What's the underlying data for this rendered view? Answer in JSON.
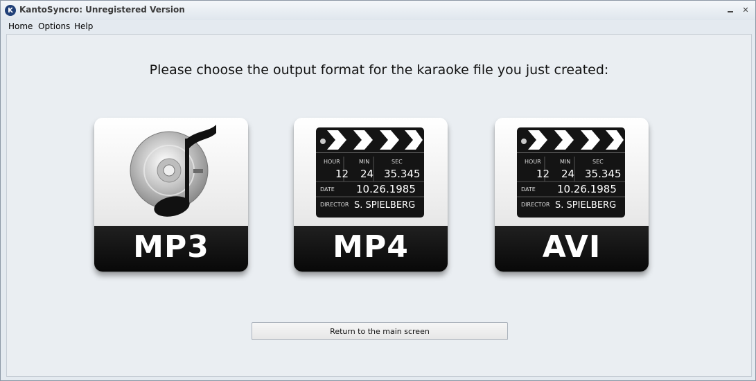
{
  "window": {
    "title": "KantoSyncro: Unregistered Version",
    "app_icon_letter": "K",
    "close_glyph": "✕"
  },
  "menu": {
    "items": [
      "Home",
      "Options",
      "Help"
    ]
  },
  "main": {
    "prompt": "Please choose the output format for the karaoke file you just created:",
    "formats": [
      {
        "label": "MP3",
        "icon": "music-cd-icon"
      },
      {
        "label": "MP4",
        "icon": "clapperboard-icon"
      },
      {
        "label": "AVI",
        "icon": "clapperboard-icon"
      }
    ],
    "clapperboard": {
      "hour_label": "HOUR",
      "min_label": "MIN",
      "sec_label": "SEC",
      "hour": "12",
      "min": "24",
      "sec": "35.345",
      "date_label": "DATE",
      "date": "10.26.1985",
      "director_label": "DIRECTOR",
      "director": "S. SPIELBERG"
    },
    "return_button_label": "Return to the main screen"
  }
}
